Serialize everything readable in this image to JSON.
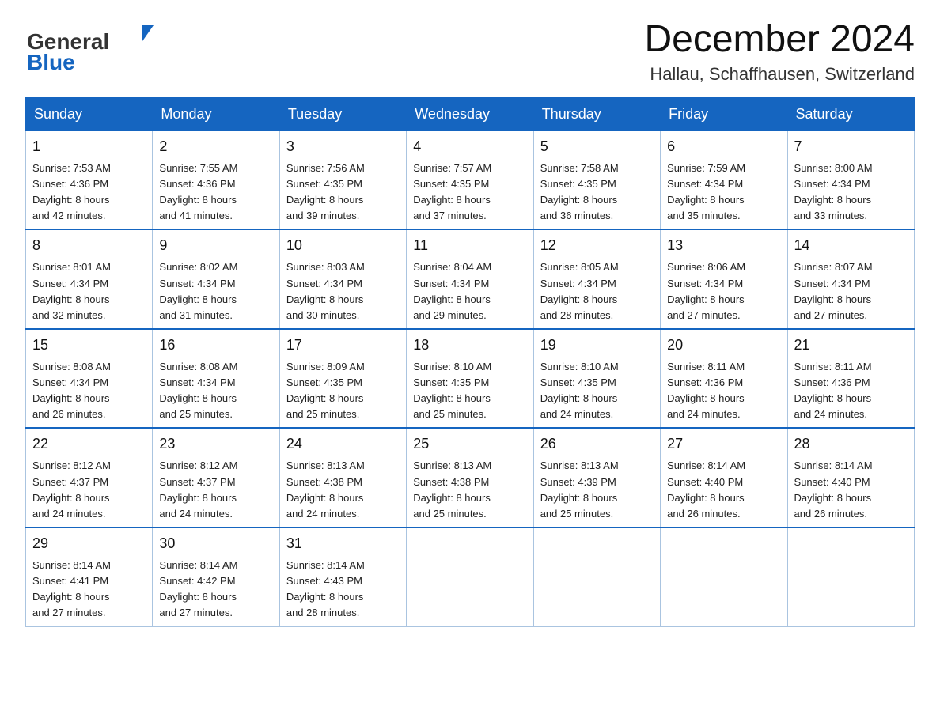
{
  "header": {
    "logo_general": "General",
    "logo_blue": "Blue",
    "month_title": "December 2024",
    "location": "Hallau, Schaffhausen, Switzerland"
  },
  "days_of_week": [
    "Sunday",
    "Monday",
    "Tuesday",
    "Wednesday",
    "Thursday",
    "Friday",
    "Saturday"
  ],
  "weeks": [
    [
      {
        "day": "1",
        "sunrise": "7:53 AM",
        "sunset": "4:36 PM",
        "daylight": "8 hours and 42 minutes."
      },
      {
        "day": "2",
        "sunrise": "7:55 AM",
        "sunset": "4:36 PM",
        "daylight": "8 hours and 41 minutes."
      },
      {
        "day": "3",
        "sunrise": "7:56 AM",
        "sunset": "4:35 PM",
        "daylight": "8 hours and 39 minutes."
      },
      {
        "day": "4",
        "sunrise": "7:57 AM",
        "sunset": "4:35 PM",
        "daylight": "8 hours and 37 minutes."
      },
      {
        "day": "5",
        "sunrise": "7:58 AM",
        "sunset": "4:35 PM",
        "daylight": "8 hours and 36 minutes."
      },
      {
        "day": "6",
        "sunrise": "7:59 AM",
        "sunset": "4:34 PM",
        "daylight": "8 hours and 35 minutes."
      },
      {
        "day": "7",
        "sunrise": "8:00 AM",
        "sunset": "4:34 PM",
        "daylight": "8 hours and 33 minutes."
      }
    ],
    [
      {
        "day": "8",
        "sunrise": "8:01 AM",
        "sunset": "4:34 PM",
        "daylight": "8 hours and 32 minutes."
      },
      {
        "day": "9",
        "sunrise": "8:02 AM",
        "sunset": "4:34 PM",
        "daylight": "8 hours and 31 minutes."
      },
      {
        "day": "10",
        "sunrise": "8:03 AM",
        "sunset": "4:34 PM",
        "daylight": "8 hours and 30 minutes."
      },
      {
        "day": "11",
        "sunrise": "8:04 AM",
        "sunset": "4:34 PM",
        "daylight": "8 hours and 29 minutes."
      },
      {
        "day": "12",
        "sunrise": "8:05 AM",
        "sunset": "4:34 PM",
        "daylight": "8 hours and 28 minutes."
      },
      {
        "day": "13",
        "sunrise": "8:06 AM",
        "sunset": "4:34 PM",
        "daylight": "8 hours and 27 minutes."
      },
      {
        "day": "14",
        "sunrise": "8:07 AM",
        "sunset": "4:34 PM",
        "daylight": "8 hours and 27 minutes."
      }
    ],
    [
      {
        "day": "15",
        "sunrise": "8:08 AM",
        "sunset": "4:34 PM",
        "daylight": "8 hours and 26 minutes."
      },
      {
        "day": "16",
        "sunrise": "8:08 AM",
        "sunset": "4:34 PM",
        "daylight": "8 hours and 25 minutes."
      },
      {
        "day": "17",
        "sunrise": "8:09 AM",
        "sunset": "4:35 PM",
        "daylight": "8 hours and 25 minutes."
      },
      {
        "day": "18",
        "sunrise": "8:10 AM",
        "sunset": "4:35 PM",
        "daylight": "8 hours and 25 minutes."
      },
      {
        "day": "19",
        "sunrise": "8:10 AM",
        "sunset": "4:35 PM",
        "daylight": "8 hours and 24 minutes."
      },
      {
        "day": "20",
        "sunrise": "8:11 AM",
        "sunset": "4:36 PM",
        "daylight": "8 hours and 24 minutes."
      },
      {
        "day": "21",
        "sunrise": "8:11 AM",
        "sunset": "4:36 PM",
        "daylight": "8 hours and 24 minutes."
      }
    ],
    [
      {
        "day": "22",
        "sunrise": "8:12 AM",
        "sunset": "4:37 PM",
        "daylight": "8 hours and 24 minutes."
      },
      {
        "day": "23",
        "sunrise": "8:12 AM",
        "sunset": "4:37 PM",
        "daylight": "8 hours and 24 minutes."
      },
      {
        "day": "24",
        "sunrise": "8:13 AM",
        "sunset": "4:38 PM",
        "daylight": "8 hours and 24 minutes."
      },
      {
        "day": "25",
        "sunrise": "8:13 AM",
        "sunset": "4:38 PM",
        "daylight": "8 hours and 25 minutes."
      },
      {
        "day": "26",
        "sunrise": "8:13 AM",
        "sunset": "4:39 PM",
        "daylight": "8 hours and 25 minutes."
      },
      {
        "day": "27",
        "sunrise": "8:14 AM",
        "sunset": "4:40 PM",
        "daylight": "8 hours and 26 minutes."
      },
      {
        "day": "28",
        "sunrise": "8:14 AM",
        "sunset": "4:40 PM",
        "daylight": "8 hours and 26 minutes."
      }
    ],
    [
      {
        "day": "29",
        "sunrise": "8:14 AM",
        "sunset": "4:41 PM",
        "daylight": "8 hours and 27 minutes."
      },
      {
        "day": "30",
        "sunrise": "8:14 AM",
        "sunset": "4:42 PM",
        "daylight": "8 hours and 27 minutes."
      },
      {
        "day": "31",
        "sunrise": "8:14 AM",
        "sunset": "4:43 PM",
        "daylight": "8 hours and 28 minutes."
      },
      null,
      null,
      null,
      null
    ]
  ],
  "sunrise_label": "Sunrise:",
  "sunset_label": "Sunset:",
  "daylight_label": "Daylight:"
}
